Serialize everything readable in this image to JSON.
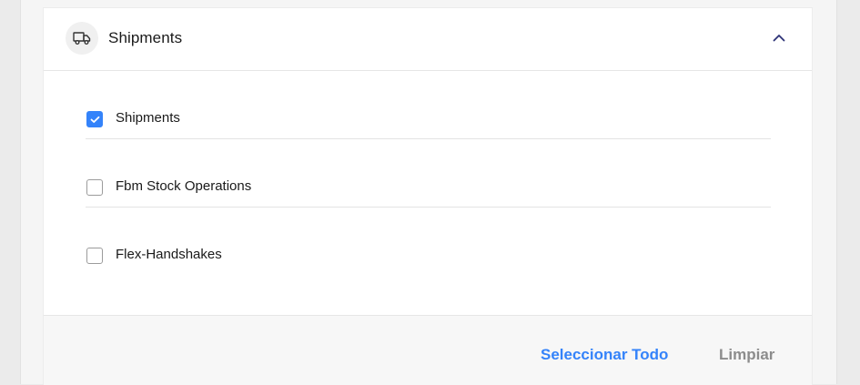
{
  "section": {
    "title": "Shipments",
    "icon": "truck-icon",
    "collapse_icon": "chevron-up-icon"
  },
  "options": [
    {
      "label": "Shipments",
      "checked": true
    },
    {
      "label": "Fbm Stock Operations",
      "checked": false
    },
    {
      "label": "Flex-Handshakes",
      "checked": false
    }
  ],
  "footer": {
    "select_all_label": "Seleccionar Todo",
    "clear_label": "Limpiar"
  },
  "colors": {
    "accent": "#3483fa",
    "muted_button": "#8c8c8c",
    "text": "#1a1a1a"
  }
}
